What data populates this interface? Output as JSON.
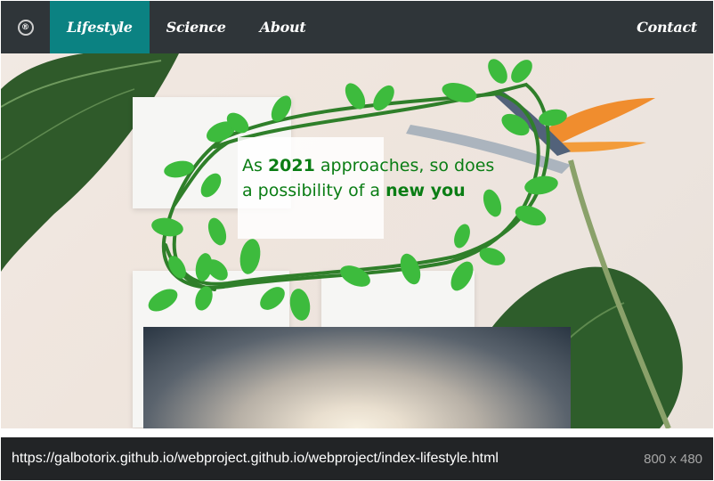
{
  "navbar": {
    "brand_symbol": "®",
    "items": [
      {
        "label": "Lifestyle",
        "active": true
      },
      {
        "label": "Science",
        "active": false
      },
      {
        "label": "About",
        "active": false
      }
    ],
    "contact_label": "Contact",
    "colors": {
      "bar": "#2f3539",
      "active": "#0b8282"
    }
  },
  "hero": {
    "headline_pre": "As ",
    "headline_year": "2021",
    "headline_mid": " approaches, so does a possibility of a ",
    "headline_emph": "new you",
    "text_color": "#0a7d14"
  },
  "status": {
    "url": "https://galbotorix.github.io/webproject.github.io/webproject/index-lifestyle.html",
    "dimensions": "800 x 480"
  }
}
